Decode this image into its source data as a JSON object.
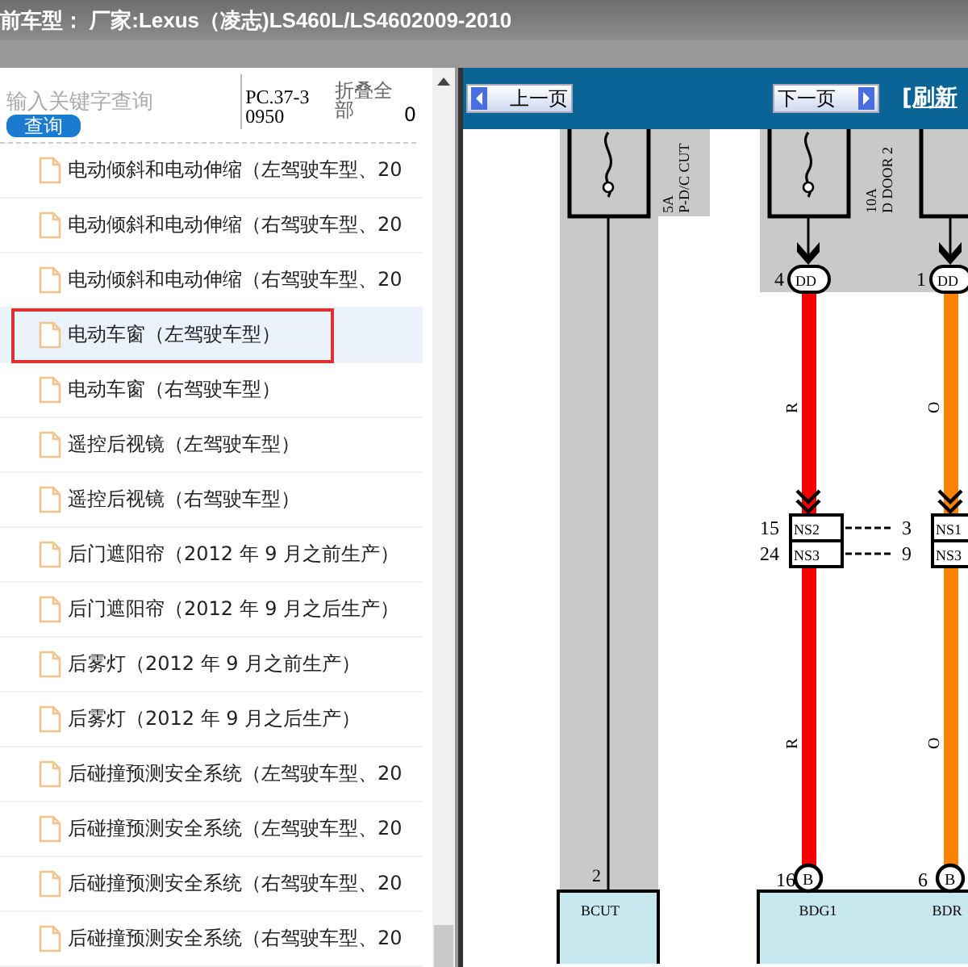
{
  "title_bar": {
    "text": "前车型： 厂家:Lexus（凌志)LS460L/LS4602009-2010"
  },
  "sidebar": {
    "search": {
      "placeholder": "输入关键字查询"
    },
    "search_button": "查询",
    "code": "PC.37-30950",
    "collapse_all": "折叠全部",
    "count": "0",
    "items": [
      {
        "label": "电动倾斜和电动伸缩（左驾驶车型、20",
        "selected": false
      },
      {
        "label": "电动倾斜和电动伸缩（右驾驶车型、20",
        "selected": false
      },
      {
        "label": "电动倾斜和电动伸缩（右驾驶车型、20",
        "selected": false
      },
      {
        "label": "电动车窗（左驾驶车型）",
        "selected": true
      },
      {
        "label": "电动车窗（右驾驶车型）",
        "selected": false
      },
      {
        "label": "遥控后视镜（左驾驶车型）",
        "selected": false
      },
      {
        "label": "遥控后视镜（右驾驶车型）",
        "selected": false
      },
      {
        "label": "后门遮阳帘（2012 年 9 月之前生产）",
        "selected": false
      },
      {
        "label": "后门遮阳帘（2012 年 9 月之后生产）",
        "selected": false
      },
      {
        "label": "后雾灯（2012 年 9 月之前生产）",
        "selected": false
      },
      {
        "label": "后雾灯（2012 年 9 月之后生产）",
        "selected": false
      },
      {
        "label": "后碰撞预测安全系统（左驾驶车型、20",
        "selected": false
      },
      {
        "label": "后碰撞预测安全系统（左驾驶车型、20",
        "selected": false
      },
      {
        "label": "后碰撞预测安全系统（右驾驶车型、20",
        "selected": false
      },
      {
        "label": "后碰撞预测安全系统（右驾驶车型、20",
        "selected": false
      }
    ]
  },
  "viewer": {
    "prev_button": "上一页",
    "next_button": "下一页",
    "refresh_link": "[刷新",
    "diagram": {
      "fuses": [
        {
          "rating": "5A",
          "name": "P-D/C CUT"
        },
        {
          "rating": "10A",
          "name": "D DOOR 2"
        }
      ],
      "bcut": {
        "pin": "2",
        "terminal": "BCUT"
      },
      "wires": [
        {
          "codes": [
            "R",
            "R"
          ],
          "color": "#f40000",
          "top_pin": "4",
          "top_connector": "DD",
          "junction": [
            {
              "pin": "15",
              "connector": "NS2"
            },
            {
              "pin": "24",
              "connector": "NS3"
            }
          ],
          "bottom_pin": "16",
          "bottom_connector": "B",
          "terminal": "BDG1"
        },
        {
          "codes": [
            "O",
            "O"
          ],
          "color": "#f98200",
          "top_pin": "1",
          "top_connector": "DD",
          "junction": [
            {
              "pin": "3",
              "connector": "NS1"
            },
            {
              "pin": "9",
              "connector": "NS3"
            }
          ],
          "bottom_pin": "6",
          "bottom_connector": "B",
          "terminal": "BDR"
        }
      ]
    }
  }
}
